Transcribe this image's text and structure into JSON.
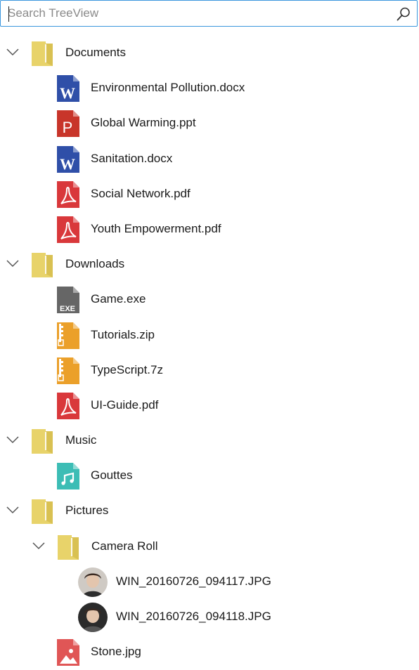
{
  "search": {
    "placeholder": "Search TreeView",
    "value": ""
  },
  "tree": [
    {
      "label": "Documents",
      "kind": "folder",
      "level": 0,
      "expanded": true
    },
    {
      "label": "Environmental Pollution.docx",
      "kind": "word",
      "level": 1
    },
    {
      "label": "Global Warming.ppt",
      "kind": "ppt",
      "level": 1
    },
    {
      "label": "Sanitation.docx",
      "kind": "word",
      "level": 1
    },
    {
      "label": "Social Network.pdf",
      "kind": "pdf",
      "level": 1
    },
    {
      "label": "Youth Empowerment.pdf",
      "kind": "pdf",
      "level": 1
    },
    {
      "label": "Downloads",
      "kind": "folder",
      "level": 0,
      "expanded": true
    },
    {
      "label": "Game.exe",
      "kind": "exe",
      "level": 1
    },
    {
      "label": "Tutorials.zip",
      "kind": "zip",
      "level": 1
    },
    {
      "label": "TypeScript.7z",
      "kind": "zip",
      "level": 1
    },
    {
      "label": "UI-Guide.pdf",
      "kind": "pdf",
      "level": 1
    },
    {
      "label": "Music",
      "kind": "folder",
      "level": 0,
      "expanded": true
    },
    {
      "label": "Gouttes",
      "kind": "music",
      "level": 1
    },
    {
      "label": "Pictures",
      "kind": "folder",
      "level": 0,
      "expanded": true
    },
    {
      "label": "Camera Roll",
      "kind": "folder",
      "level": 1,
      "expanded": true
    },
    {
      "label": "WIN_20160726_094117.JPG",
      "kind": "photo",
      "level": 2
    },
    {
      "label": "WIN_20160726_094118.JPG",
      "kind": "photo",
      "level": 2
    },
    {
      "label": "Stone.jpg",
      "kind": "image",
      "level": 1
    }
  ],
  "icon_colors": {
    "folder": "#e8d36a",
    "word": "#2f4fa8",
    "ppt": "#c8352a",
    "pdf": "#d9383b",
    "exe": "#666666",
    "zip": "#eba02a",
    "music": "#3cbdb5",
    "image": "#e05656"
  }
}
